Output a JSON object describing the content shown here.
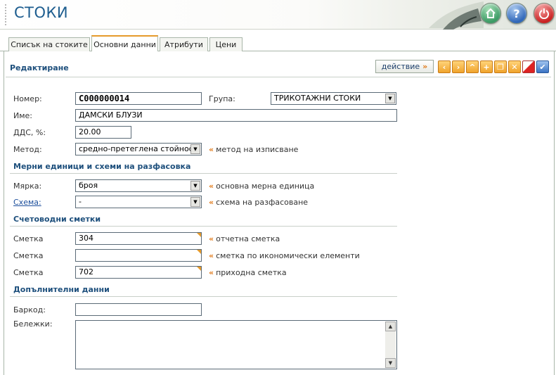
{
  "header": {
    "title": "СТОКИ",
    "buttons": [
      {
        "icon": "home-icon"
      },
      {
        "icon": "help-icon",
        "glyph": "?"
      },
      {
        "icon": "power-icon"
      }
    ]
  },
  "tabs": [
    {
      "label": "Списък на стоките",
      "active": false
    },
    {
      "label": "Основни данни",
      "active": true
    },
    {
      "label": "Атрибути",
      "active": false
    },
    {
      "label": "Цени",
      "active": false
    }
  ],
  "editor": {
    "section_title": "Редактиране",
    "action_label": "действие",
    "action_arrow": "»",
    "toolbar": [
      {
        "icon": "prev-icon",
        "glyph": "‹"
      },
      {
        "icon": "next-icon",
        "glyph": "›"
      },
      {
        "icon": "up-icon",
        "glyph": "^"
      },
      {
        "icon": "add-icon",
        "glyph": "+"
      },
      {
        "icon": "copy-icon",
        "glyph": "❐"
      },
      {
        "icon": "delete-icon",
        "glyph": "✕"
      },
      {
        "icon": "cancel-icon",
        "glyph": ""
      },
      {
        "icon": "confirm-icon",
        "glyph": "✔"
      }
    ]
  },
  "form": {
    "number_label": "Номер:",
    "number_value": "C000000014",
    "group_label": "Група:",
    "group_value": "ТРИКОТАЖНИ СТОКИ",
    "name_label": "Име:",
    "name_value": "ДАМСКИ БЛУЗИ",
    "vat_label": "ДДС, %:",
    "vat_value": "20.00",
    "method_label": "Метод:",
    "method_value": "средно-претеглена стойност",
    "method_hint": "метод на изписване",
    "units_title": "Мерни единици и схеми на разфасовка",
    "unit_label": "Мярка:",
    "unit_value": "броя",
    "unit_hint": "основна мерна единица",
    "scheme_label": "Схема:",
    "scheme_value": "-",
    "scheme_hint": "схема на разфасоване",
    "accounts_title": "Счетоводни сметки",
    "accounts": [
      {
        "label": "Сметка",
        "value": "304",
        "hint": "отчетна сметка"
      },
      {
        "label": "Сметка",
        "value": "",
        "hint": "сметка по икономически елементи"
      },
      {
        "label": "Сметка",
        "value": "702",
        "hint": "приходна сметка"
      }
    ],
    "extra_title": "Допълнителни данни",
    "barcode_label": "Баркод:",
    "barcode_value": "",
    "notes_label": "Бележки:",
    "notes_value": ""
  },
  "colors": {
    "accent": "#e69a2b",
    "title_blue": "#1d5d8f",
    "section_blue": "#1d4f7c"
  },
  "hint_mark": "«"
}
